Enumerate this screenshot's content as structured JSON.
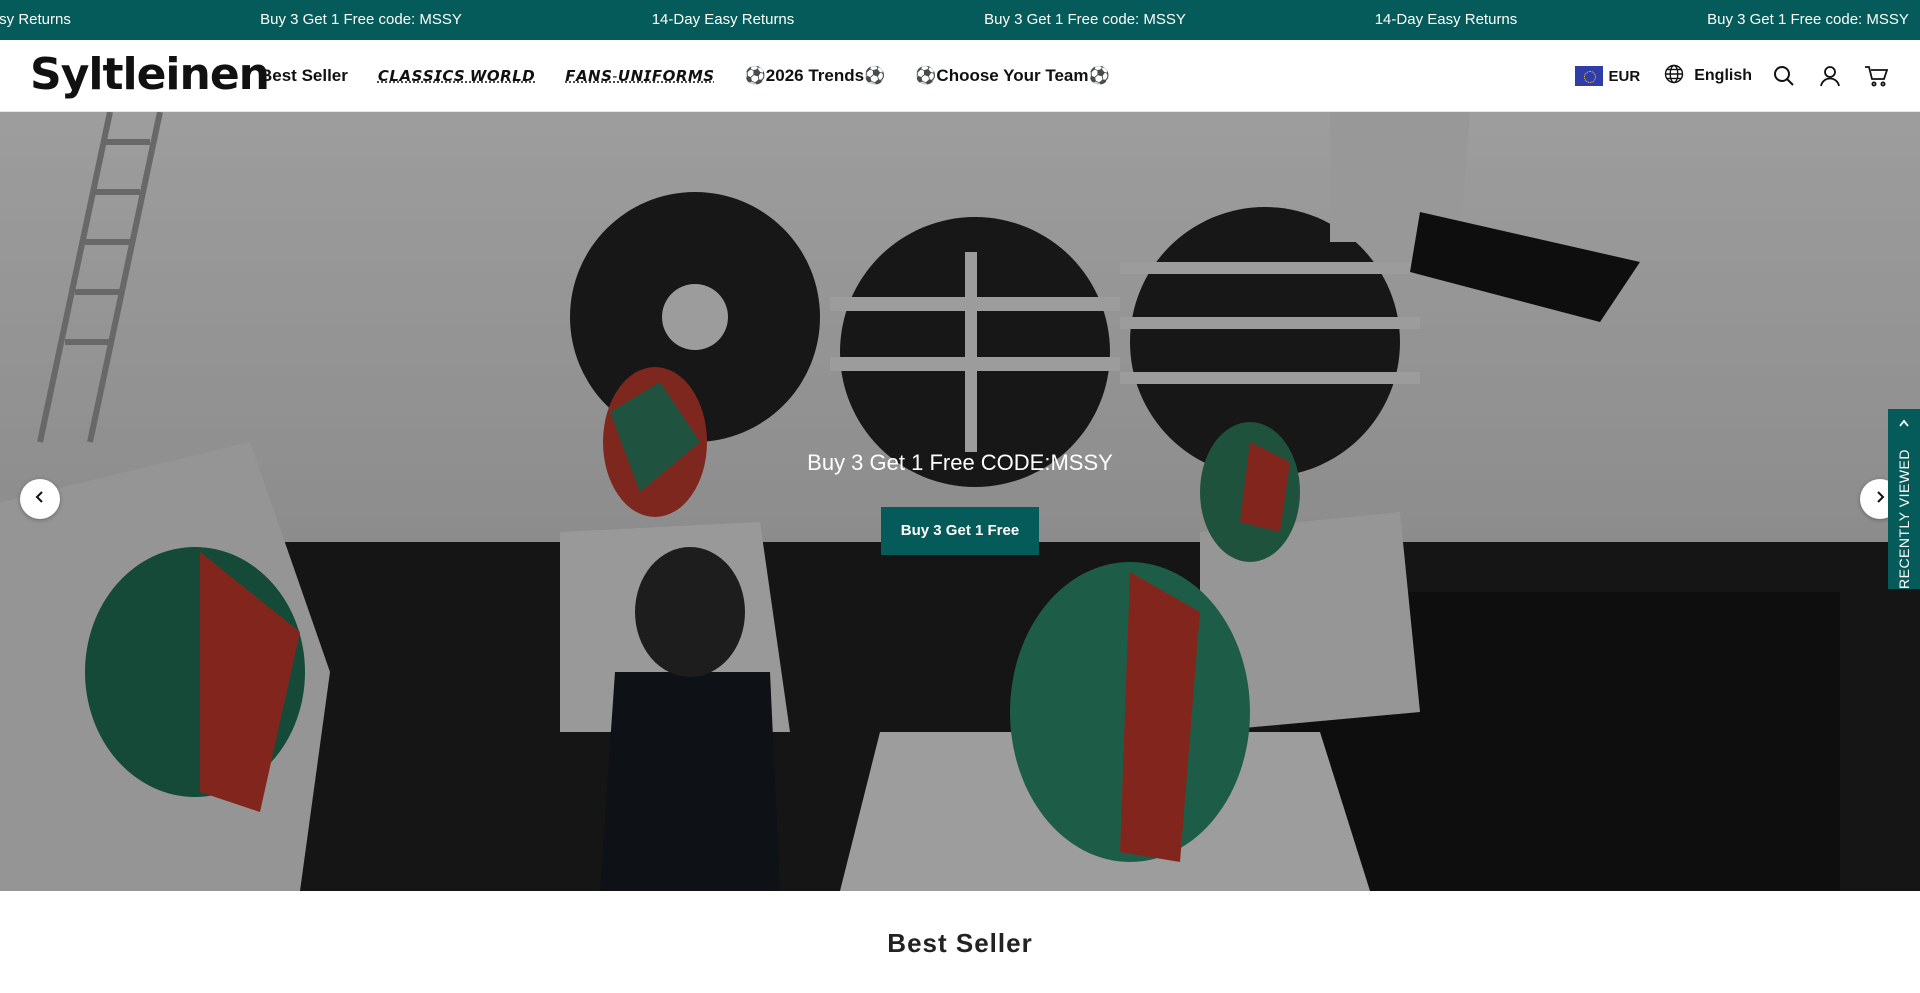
{
  "announcement": {
    "messages": [
      "sy Returns",
      "Buy 3 Get 1 Free code: MSSY",
      "14-Day Easy Returns",
      "Buy 3 Get 1 Free code: MSSY",
      "14-Day Easy Returns",
      "Buy 3 Get 1 Free code: MSSY"
    ],
    "background": "#055a5a"
  },
  "header": {
    "logo": "Syltleinen",
    "nav": [
      {
        "label": "Best Seller"
      },
      {
        "label": "𝘾𝙇𝘼𝙎𝙎𝙄𝘾𝙎 𝙒𝙊𝙍𝙇𝘿"
      },
      {
        "label": "𝙁𝘼𝙉𝙎-𝙐𝙉𝙄𝙁𝙊𝙍𝙈𝙎"
      },
      {
        "label": "⚽2026 Trends⚽"
      },
      {
        "label": "⚽Choose Your Team⚽"
      }
    ],
    "currency": "EUR",
    "language": "English",
    "icons": [
      "eu-flag-icon",
      "globe-icon",
      "search-icon",
      "account-icon",
      "cart-icon"
    ]
  },
  "hero": {
    "headline": "Buy 3 Get 1 Free CODE:MSSY",
    "button_label": "Buy 3 Get 1 Free",
    "button_color": "#055a5a"
  },
  "recently_viewed": {
    "label": "RECENTLY VIEWED"
  },
  "section": {
    "title": "Best Seller"
  }
}
